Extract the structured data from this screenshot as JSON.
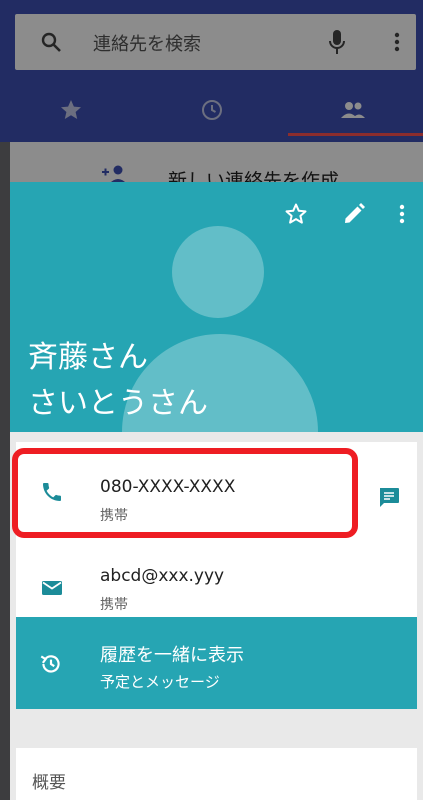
{
  "background": {
    "search": {
      "placeholder": "連絡先を検索"
    },
    "tabs": [
      {
        "icon": "star-icon"
      },
      {
        "icon": "clock-icon"
      },
      {
        "icon": "people-icon"
      }
    ],
    "new_contact_label": "新しい連絡先を作成"
  },
  "contact": {
    "name": "斉藤さん",
    "reading": "さいとうさん",
    "phone": {
      "value": "080-XXXX-XXXX",
      "type": "携帯"
    },
    "email": {
      "value": "abcd@xxx.yyy",
      "type": "携帯"
    },
    "history": {
      "title": "履歴を一緒に表示",
      "subtitle": "予定とメッセージ"
    },
    "summary_label": "概要"
  },
  "colors": {
    "app_bar": "#3f51b5",
    "contact_header": "#26a5b3",
    "highlight": "#ee1d23"
  }
}
